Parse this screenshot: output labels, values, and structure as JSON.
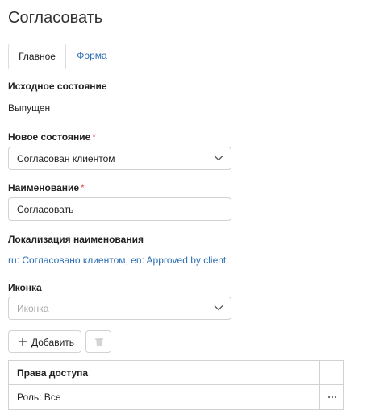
{
  "page": {
    "title": "Согласовать"
  },
  "tabs": [
    {
      "label": "Главное",
      "active": true
    },
    {
      "label": "Форма",
      "active": false
    }
  ],
  "source_state": {
    "label": "Исходное состояние",
    "value": "Выпущен"
  },
  "new_state": {
    "label": "Новое состояние",
    "required": "*",
    "value": "Согласован клиентом"
  },
  "name": {
    "label": "Наименование",
    "required": "*",
    "value": "Согласовать"
  },
  "localization": {
    "label": "Локализация наименования",
    "value": "ru: Согласовано клиентом, en: Approved by client"
  },
  "icon": {
    "label": "Иконка",
    "placeholder": "Иконка"
  },
  "toolbar": {
    "add_label": "Добавить"
  },
  "access_table": {
    "header": "Права доступа",
    "rows": [
      {
        "value": "Роль: Все"
      }
    ]
  },
  "icons": {
    "chevron": "chevron-down-icon",
    "plus": "plus-icon",
    "delete": "trash-icon",
    "more": "more-icon"
  },
  "colors": {
    "accent": "#2a6db5",
    "required": "#d9534f",
    "border": "#d2d2d2"
  }
}
